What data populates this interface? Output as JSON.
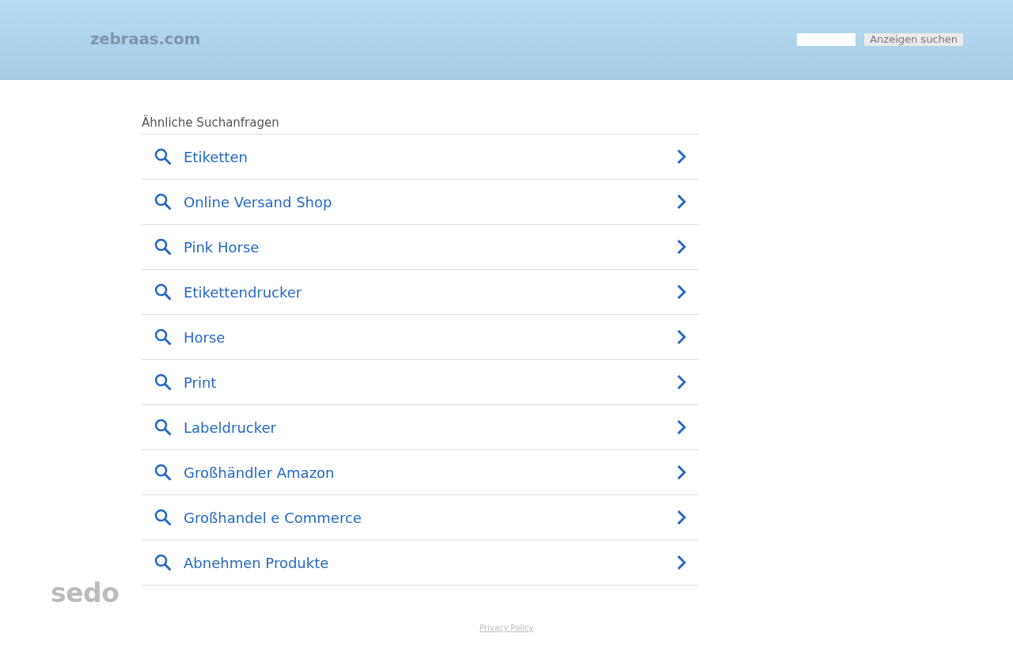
{
  "header": {
    "logo": "zebraas.com",
    "search_button": "Anzeigen suchen"
  },
  "related": {
    "heading": "Ähnliche Suchanfragen",
    "items": [
      {
        "label": "Etiketten"
      },
      {
        "label": "Online Versand Shop"
      },
      {
        "label": "Pink Horse"
      },
      {
        "label": "Etikettendrucker"
      },
      {
        "label": "Horse"
      },
      {
        "label": "Print"
      },
      {
        "label": "Labeldrucker"
      },
      {
        "label": "Großhändler Amazon"
      },
      {
        "label": "Großhandel e Commerce"
      },
      {
        "label": "Abnehmen Produkte"
      }
    ]
  },
  "footer": {
    "brand": "sedo",
    "privacy_link": "Privacy Policy"
  }
}
